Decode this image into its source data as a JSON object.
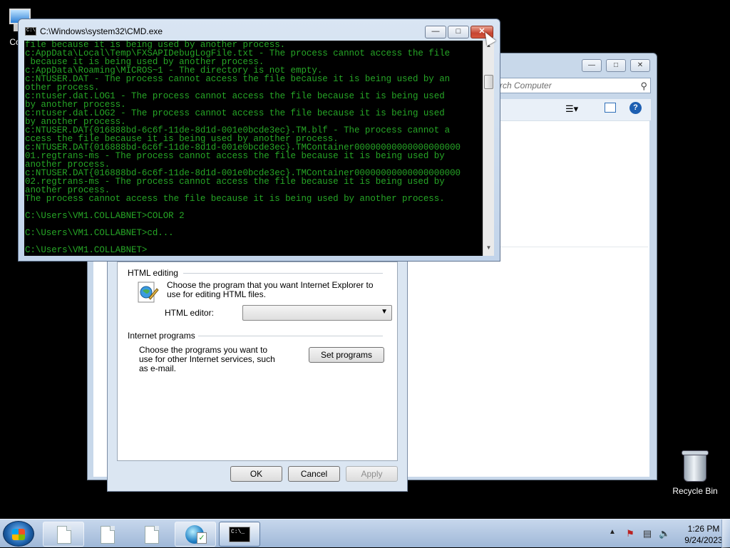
{
  "desktop": {
    "computer_label": "Co",
    "recycle_bin_label": "Recycle Bin"
  },
  "explorer": {
    "search_placeholder": "rch Computer",
    "search_icon": "search-icon",
    "window_controls": [
      "minimize",
      "maximize",
      "close"
    ]
  },
  "cmd": {
    "title": "C:\\Windows\\system32\\CMD.exe",
    "lines": [
      "file because it is being used by another process.",
      "c:AppData\\Local\\Temp\\FXSAPIDebugLogFile.txt - The process cannot access the file",
      " because it is being used by another process.",
      "c:AppData\\Roaming\\MICROS~1 - The directory is not empty.",
      "c:NTUSER.DAT - The process cannot access the file because it is being used by an",
      "other process.",
      "c:ntuser.dat.LOG1 - The process cannot access the file because it is being used",
      "by another process.",
      "c:ntuser.dat.LOG2 - The process cannot access the file because it is being used",
      "by another process.",
      "c:NTUSER.DAT{016888bd-6c6f-11de-8d1d-001e0bcde3ec}.TM.blf - The process cannot a",
      "ccess the file because it is being used by another process.",
      "c:NTUSER.DAT{016888bd-6c6f-11de-8d1d-001e0bcde3ec}.TMContainer00000000000000000000",
      "01.regtrans-ms - The process cannot access the file because it is being used by",
      "another process.",
      "c:NTUSER.DAT{016888bd-6c6f-11de-8d1d-001e0bcde3ec}.TMContainer00000000000000000000",
      "02.regtrans-ms - The process cannot access the file because it is being used by",
      "another process.",
      "The process cannot access the file because it is being used by another process.",
      "",
      "C:\\Users\\VM1.COLLABNET>COLOR 2",
      "",
      "C:\\Users\\VM1.COLLABNET>cd...",
      "",
      "C:\\Users\\VM1.COLLABNET>"
    ],
    "text_color": "#26a626"
  },
  "dialog": {
    "html_editing": {
      "title": "HTML editing",
      "description": "Choose the program that you want Internet Explorer to use for editing HTML files.",
      "editor_label": "HTML editor:",
      "editor_value": ""
    },
    "internet_programs": {
      "title": "Internet programs",
      "description": "Choose the programs you want to use for other Internet services, such as e-mail.",
      "set_programs_label": "Set programs"
    },
    "buttons": {
      "ok": "OK",
      "cancel": "Cancel",
      "apply": "Apply"
    }
  },
  "taskbar": {
    "buttons": [
      "document",
      "document",
      "document",
      "internet-options",
      "cmd"
    ],
    "clock_time": "1:26 PM",
    "clock_date": "9/24/2023"
  }
}
